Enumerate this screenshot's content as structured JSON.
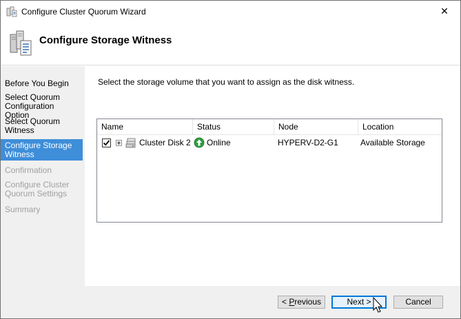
{
  "window": {
    "title": "Configure Cluster Quorum Wizard",
    "close_symbol": "✕"
  },
  "header": {
    "heading": "Configure Storage Witness"
  },
  "sidebar": {
    "steps": [
      {
        "label": "Before You Begin",
        "state": "done"
      },
      {
        "label": "Select Quorum Configuration Option",
        "state": "done"
      },
      {
        "label": "Select Quorum Witness",
        "state": "done"
      },
      {
        "label": "Configure Storage Witness",
        "state": "active"
      },
      {
        "label": "Confirmation",
        "state": "disabled"
      },
      {
        "label": "Configure Cluster Quorum Settings",
        "state": "disabled"
      },
      {
        "label": "Summary",
        "state": "disabled"
      }
    ]
  },
  "main": {
    "instruction": "Select the storage volume that you want to assign as the disk witness.",
    "columns": [
      "Name",
      "Status",
      "Node",
      "Location"
    ],
    "rows": [
      {
        "checked": true,
        "name": "Cluster Disk 2",
        "status": "Online",
        "node": "HYPERV-D2-G1",
        "location": "Available Storage"
      }
    ]
  },
  "footer": {
    "previous_prefix": "< ",
    "previous_accel": "P",
    "previous_rest": "revious",
    "next_label": "Next >",
    "cancel_label": "Cancel"
  },
  "colors": {
    "active_step": "#3e8ed9",
    "online_icon": "#2e9e3f",
    "primary_button_border": "#0078d7"
  },
  "icons": {
    "app": "cluster-servers-icon",
    "disk": "disk-drive-icon",
    "status": "online-arrow-up-icon",
    "cursor": "mouse-pointer-icon"
  }
}
